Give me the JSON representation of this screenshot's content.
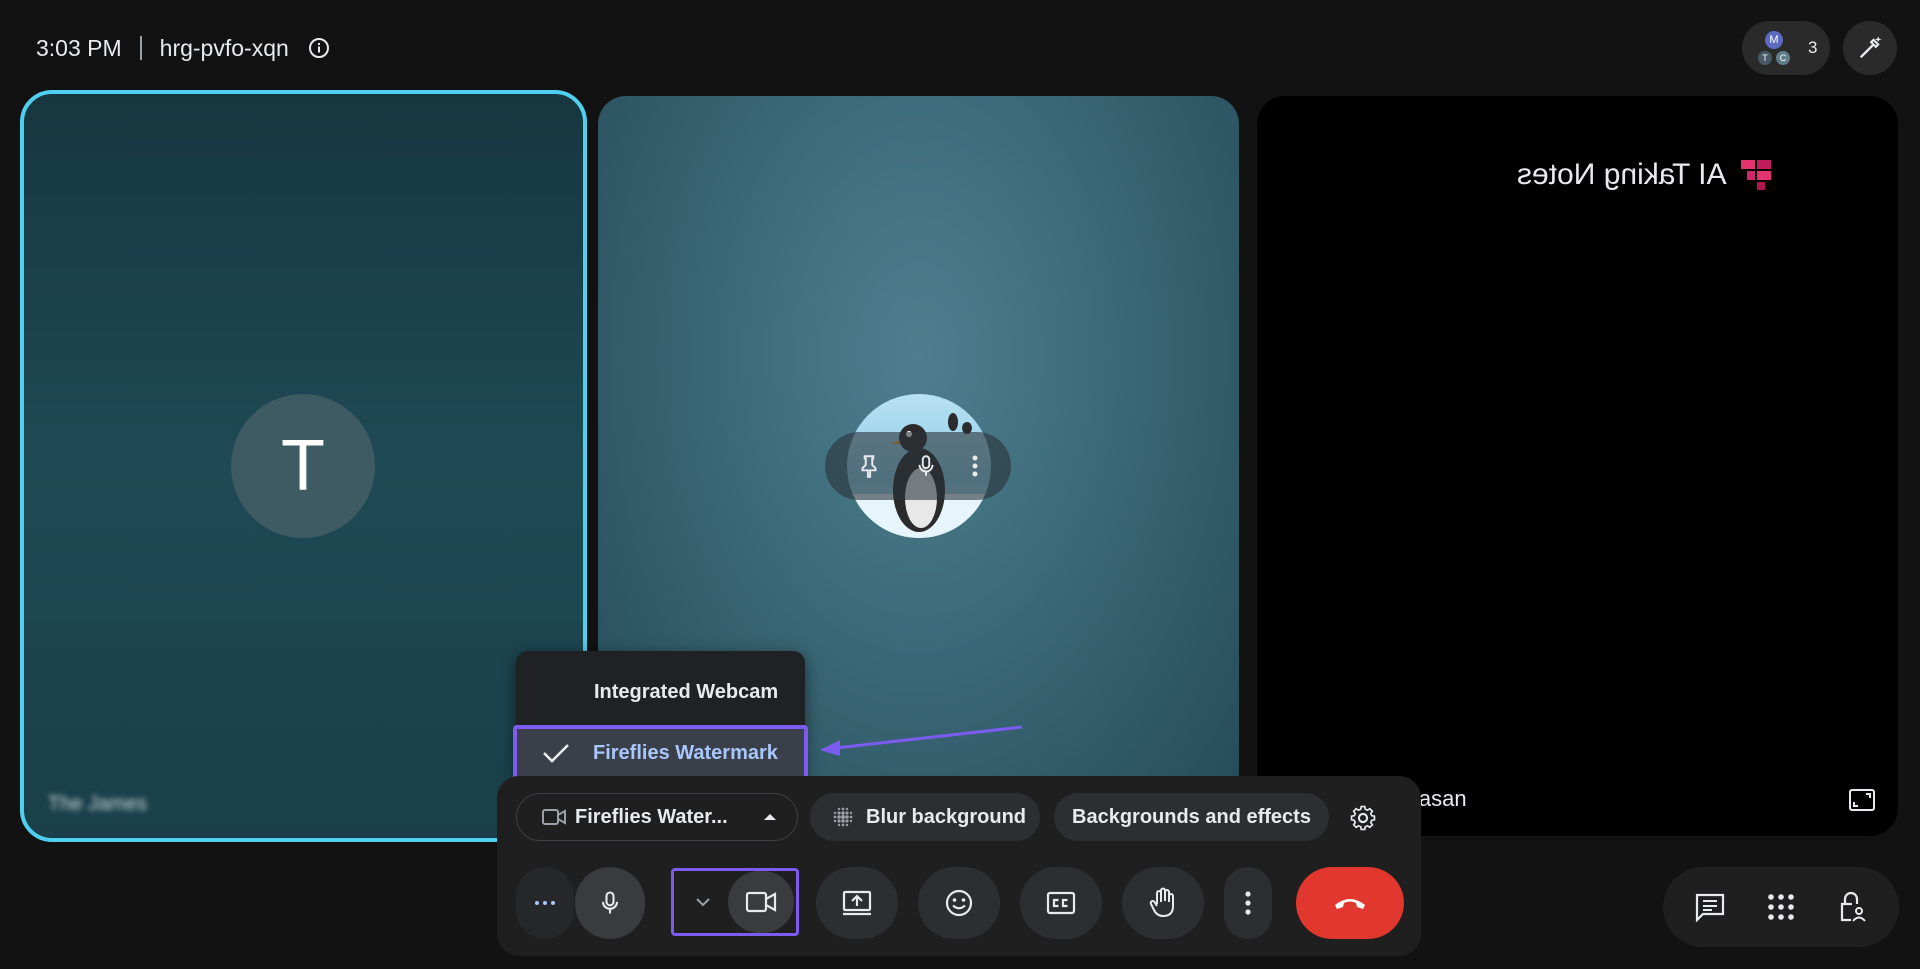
{
  "header": {
    "time": "3:03 PM",
    "meeting_code": "hrg-pvfo-xqn",
    "participants_count": "3",
    "avatars": [
      "M",
      "T",
      "C"
    ]
  },
  "tiles": {
    "tile1": {
      "avatar_letter": "T",
      "name": "The James"
    },
    "tile3": {
      "ai_notes_text": "AI Taking Notes",
      "name": "Hasan"
    }
  },
  "camera_menu": {
    "items": [
      {
        "label": "Integrated Webcam",
        "selected": false
      },
      {
        "label": "Fireflies Watermark",
        "selected": true
      }
    ]
  },
  "effects_bar": {
    "camera_select_label": "Fireflies Water...",
    "blur_label": "Blur background",
    "backgrounds_label": "Backgrounds and effects"
  },
  "colors": {
    "accent_highlight": "#7c5cf0",
    "active_speaker_border": "#4fd0f0",
    "end_call": "#e2372f"
  }
}
